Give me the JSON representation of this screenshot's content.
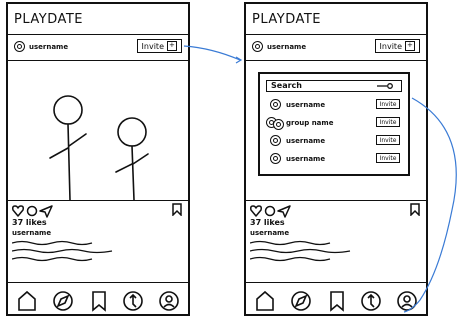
{
  "left_screen": {
    "app_title": "PLAYDATE",
    "username": "username",
    "invite_label": "Invite",
    "likes": "37 likes",
    "post_username": "username"
  },
  "right_screen": {
    "app_title": "PLAYDATE",
    "username": "username",
    "invite_label": "Invite",
    "likes": "37 likes",
    "post_username": "username",
    "search": {
      "label": "Search",
      "results": [
        {
          "name": "username",
          "invite": "Invite"
        },
        {
          "name": "group name",
          "invite": "Invite"
        },
        {
          "name": "username",
          "invite": "Invite"
        },
        {
          "name": "username",
          "invite": "Invite"
        }
      ]
    }
  },
  "colors": {
    "connector": "#3a7bd5",
    "ink": "#111111"
  },
  "icons": [
    "heart-icon",
    "comment-icon",
    "send-icon",
    "bookmark-icon",
    "home-icon",
    "explore-icon",
    "saved-icon",
    "activity-icon",
    "profile-icon"
  ]
}
